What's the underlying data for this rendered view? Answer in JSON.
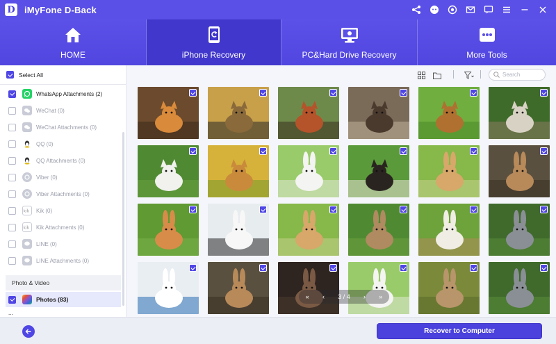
{
  "app": {
    "logo_letter": "D",
    "title": "iMyFone D-Back"
  },
  "titlebar_icons": [
    "share-icon",
    "support-icon",
    "target-icon",
    "mail-icon",
    "chat-icon",
    "menu-icon",
    "minimize-icon",
    "close-icon"
  ],
  "nav": {
    "tabs": [
      {
        "label": "HOME",
        "icon": "home-icon",
        "active": false
      },
      {
        "label": "iPhone Recovery",
        "icon": "iphone-recovery-icon",
        "active": true
      },
      {
        "label": "PC&Hard Drive Recovery",
        "icon": "monitor-icon",
        "active": false
      },
      {
        "label": "More Tools",
        "icon": "more-tools-icon",
        "active": false
      }
    ]
  },
  "sidebar": {
    "select_all": "Select All",
    "items": [
      {
        "label": "WhatsApp Attachments (2)",
        "icon": "whatsapp-icon",
        "checked": true
      },
      {
        "label": "WeChat (0)",
        "icon": "wechat-icon",
        "checked": false
      },
      {
        "label": "WeChat Attachments (0)",
        "icon": "wechat-icon",
        "checked": false
      },
      {
        "label": "QQ (0)",
        "icon": "qq-icon",
        "checked": false
      },
      {
        "label": "QQ Attachments (0)",
        "icon": "qq-icon",
        "checked": false
      },
      {
        "label": "Viber (0)",
        "icon": "viber-icon",
        "checked": false
      },
      {
        "label": "Viber Attachments (0)",
        "icon": "viber-icon",
        "checked": false
      },
      {
        "label": "Kik (0)",
        "icon": "kik-icon",
        "checked": false
      },
      {
        "label": "Kik Attachments (0)",
        "icon": "kik-icon",
        "checked": false
      },
      {
        "label": "LINE (0)",
        "icon": "line-icon",
        "checked": false
      },
      {
        "label": "LINE Attachments (0)",
        "icon": "line-icon",
        "checked": false
      }
    ],
    "section_photo_video": "Photo & Video",
    "photos": {
      "label": "Photos (83)",
      "checked": true
    },
    "more_label": "..."
  },
  "toolbar": {
    "search_placeholder": "Search",
    "icons": [
      "grid-view-icon",
      "folder-icon",
      "filter-icon"
    ]
  },
  "grid": {
    "images": [
      "tiger",
      "dog-on-street",
      "red-panda",
      "raccoon-dog",
      "deer",
      "cats",
      "white-dog",
      "golden-retriever",
      "white-rabbit",
      "guinea-pig",
      "lop-rabbit",
      "brown-rabbit",
      "orange-rabbit",
      "white-black-rabbit",
      "lop-rabbit",
      "wild-rabbit",
      "rabbit-in-hat",
      "grey-rabbit",
      "white-rabbit-laptop",
      "brown-rabbit",
      "dark-rabbit",
      "white-rabbit",
      "hare",
      "grey-rabbit"
    ],
    "all_checked": true
  },
  "pager": {
    "first": "«",
    "prev": "‹",
    "page_text": "3 / 4",
    "next": "›",
    "last": "»"
  },
  "footer": {
    "recover_label": "Recover to Computer"
  },
  "colors": {
    "brand": "#5a4fe6",
    "accent": "#4f46e5",
    "active_tab": "#4137cc"
  }
}
